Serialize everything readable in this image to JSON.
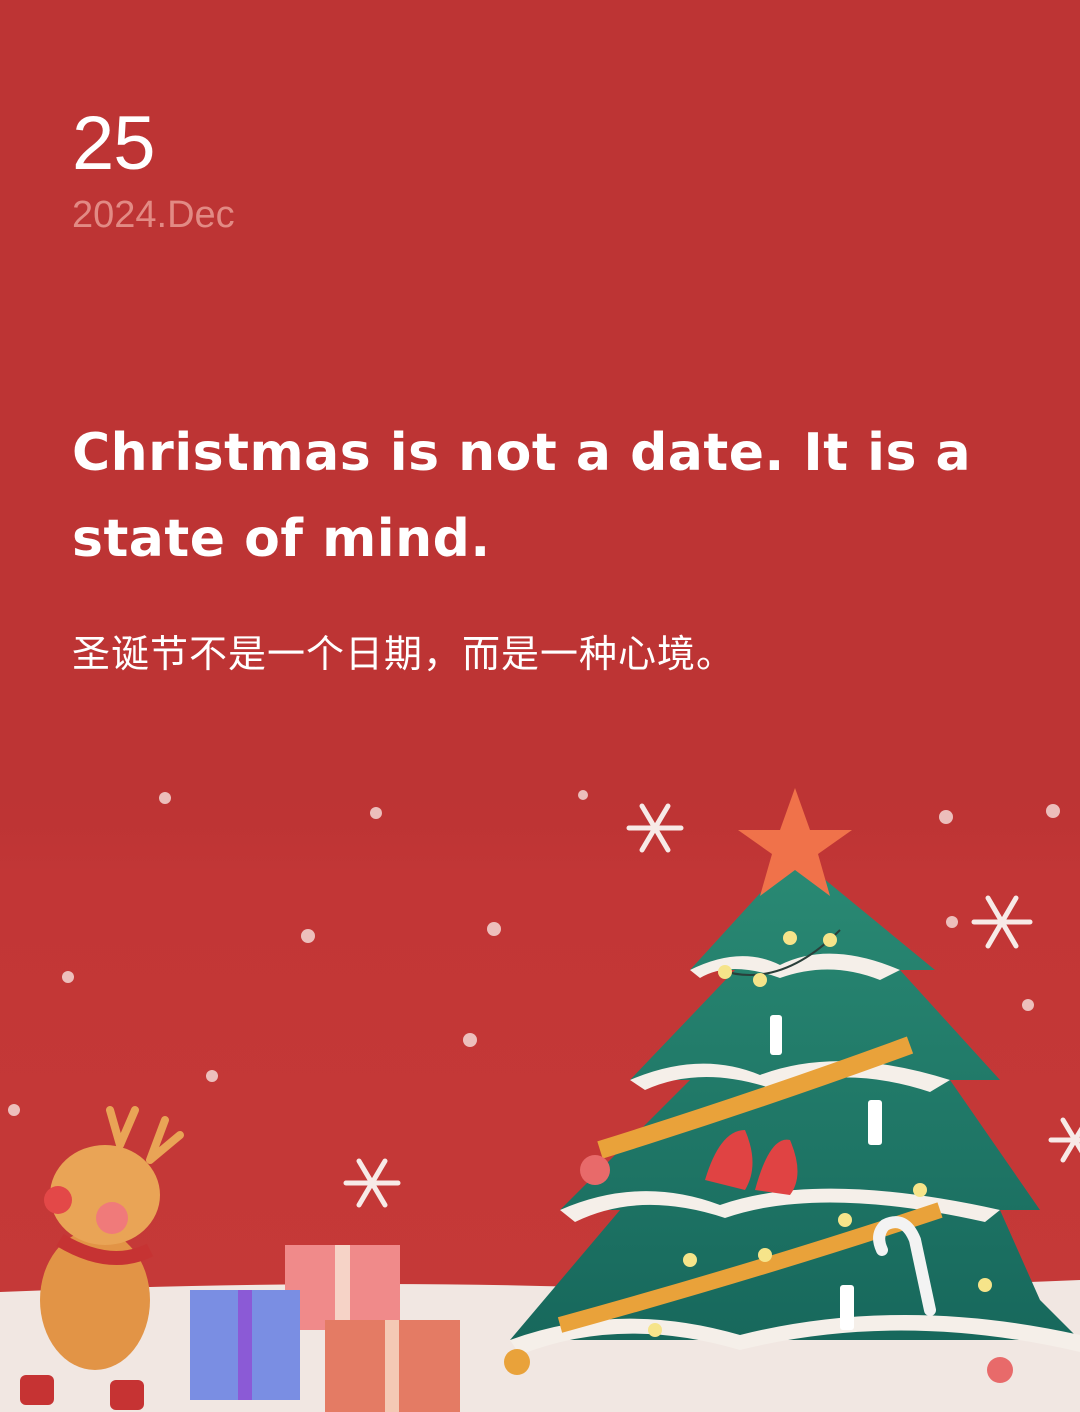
{
  "date": {
    "day": "25",
    "month_year": "2024.Dec"
  },
  "quote": {
    "english": "Christmas is not a date. It is a state of mind.",
    "chinese": "圣诞节不是一个日期，而是一种心境。"
  },
  "colors": {
    "background": "#bd3434",
    "snow": "#f1e7e2",
    "tree": "#1f7a6a",
    "ribbon": "#e9a23a",
    "star": "#f0724a"
  },
  "illustration": {
    "icons": [
      "christmas-tree-icon",
      "star-icon",
      "reindeer-icon",
      "gift-box-icon",
      "snowflake-icon",
      "bell-icon",
      "candy-cane-icon",
      "ornament-icon"
    ]
  }
}
